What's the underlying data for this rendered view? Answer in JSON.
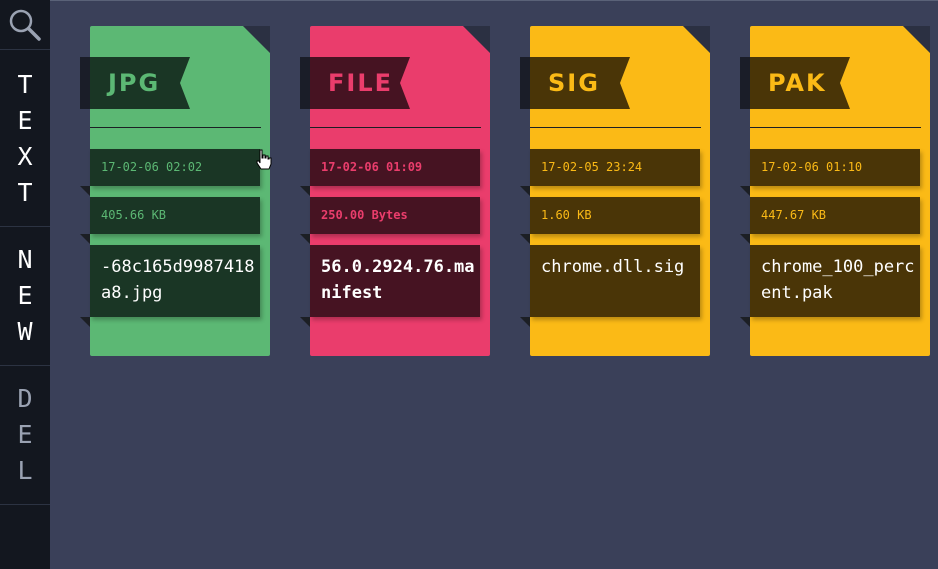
{
  "sidebar": {
    "search_icon": "search-icon",
    "items": [
      {
        "label": "TEXT",
        "letters": [
          "T",
          "E",
          "X",
          "T"
        ],
        "disabled": false
      },
      {
        "label": "NEW",
        "letters": [
          "N",
          "E",
          "W"
        ],
        "disabled": false
      },
      {
        "label": "DEL",
        "letters": [
          "D",
          "E",
          "L"
        ],
        "disabled": true
      }
    ]
  },
  "files": [
    {
      "type": "JPG",
      "date": "17-02-06 02:02",
      "size": "405.66 KB",
      "name": "-68c165d9987418a8.jpg",
      "color": "#5cb874",
      "dark": "#1a3625",
      "accent": "#5cb874"
    },
    {
      "type": "FILE",
      "date": "17-02-06 01:09",
      "size": "250.00 Bytes",
      "name": "56.0.2924.76.manifest",
      "color": "#ea3d6c",
      "dark": "#461322",
      "accent": "#ea3d6c"
    },
    {
      "type": "SIG",
      "date": "17-02-05 23:24",
      "size": "1.60 KB",
      "name": "chrome.dll.sig",
      "color": "#fbba16",
      "dark": "#4a3507",
      "accent": "#fbba16"
    },
    {
      "type": "PAK",
      "date": "17-02-06 01:10",
      "size": "447.67 KB",
      "name": "chrome_100_percent.pak",
      "color": "#fbba16",
      "dark": "#4a3507",
      "accent": "#fbba16"
    }
  ],
  "colors": {
    "background": "#3a4059",
    "sidebar": "#13171f"
  }
}
